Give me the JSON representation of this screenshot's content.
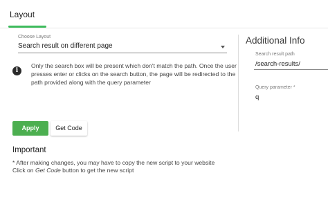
{
  "tabs": {
    "layout_label": "Layout"
  },
  "layout": {
    "label": "Choose Layout",
    "value": "Search result on different page",
    "info_text": "Only the search box will be present which don't match the path. Once the user presses enter or clicks on the search button, the page will be redirected to the path provided along with the query parameter"
  },
  "additional": {
    "title": "Additional Info",
    "path_label": "Search result path",
    "path_value": "/search-results/",
    "param_label": "Query parameter *",
    "param_value": "q"
  },
  "buttons": {
    "apply": "Apply",
    "get_code": "Get Code"
  },
  "important": {
    "title": "Important",
    "line1": "* After making changes, you may have to copy the new script to your website",
    "line2_prefix": "Click on ",
    "line2_em": "Get Code",
    "line2_suffix": " button to get the new script"
  },
  "colors": {
    "accent": "#3dbb5c",
    "apply_bg": "#4caf50"
  },
  "icons": {
    "info": "info-icon",
    "dropdown": "caret-down-icon"
  }
}
